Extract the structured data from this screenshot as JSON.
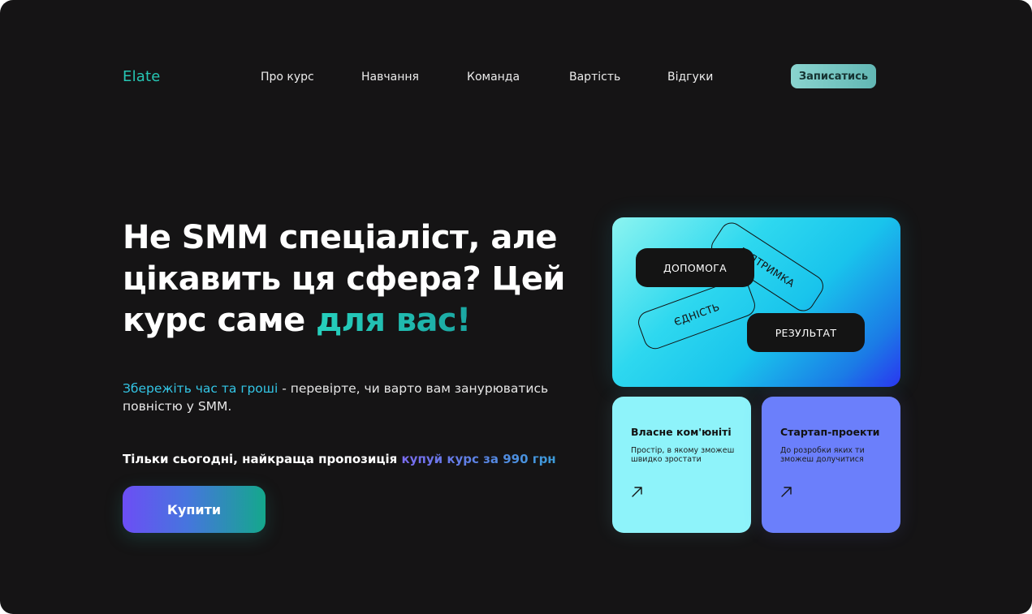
{
  "header": {
    "logo": "Elate",
    "nav": [
      "Про курс",
      "Навчання",
      "Команда",
      "Вартість",
      "Відгуки"
    ],
    "signup_label": "Записатись"
  },
  "hero": {
    "title_line1": "Не SMM спеціаліст, але",
    "title_line2": "цікавить ця сфера? Цей",
    "title_line3_plain": "курс саме ",
    "title_line3_accent": "для вас!",
    "subtitle_highlight": "Збережіть час та гроші",
    "subtitle_rest": " - перевірте, чи варто вам занурюватись повністю у SMM.",
    "offer_plain": "Тільки сьогодні, найкраща пропозиція ",
    "offer_highlight": "купуй курс за 990 грн",
    "buy_label": "Купити"
  },
  "feature_card": {
    "tags": {
      "help": "ДОПОМОГА",
      "support": "ПІДТРИМКА",
      "unity": "ЄДНІСТЬ",
      "result": "РЕЗУЛЬТАТ"
    }
  },
  "cards": [
    {
      "title": "Власне ком'юніті",
      "desc": "Простір, в якому зможеш швидко зростати",
      "icon": "arrow-up-right-icon"
    },
    {
      "title": "Стартап-проекти",
      "desc": "До розробки яких ти зможеш долучитися",
      "icon": "arrow-up-right-icon"
    }
  ],
  "colors": {
    "background": "#151415",
    "accent_teal": "#26c6b4",
    "card_cyan": "#8ef3fa",
    "card_violet": "#6b7ffb"
  }
}
